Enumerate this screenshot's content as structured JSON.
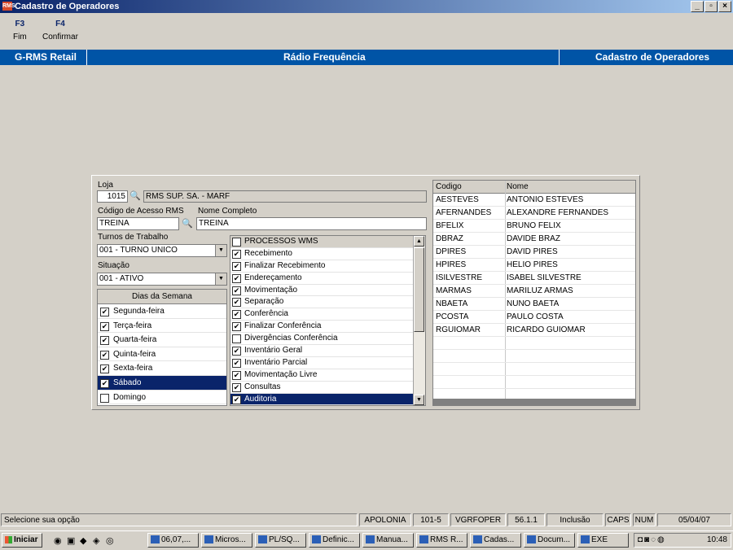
{
  "window": {
    "title": "Cadastro de Operadores",
    "app_icon": "RMS"
  },
  "fkeys": [
    {
      "key": "F3",
      "label": "Fim"
    },
    {
      "key": "F4",
      "label": "Confirmar"
    }
  ],
  "header": {
    "left": "G-RMS Retail",
    "center": "Rádio Frequência",
    "right": "Cadastro de Operadores"
  },
  "form": {
    "loja_label": "Loja",
    "loja_code": "1015",
    "loja_name": "RMS SUP. SA. - MARF",
    "codigo_label": "Código de Acesso RMS",
    "codigo_value": "TREINA",
    "nome_label": "Nome Completo",
    "nome_value": "TREINA",
    "turnos_label": "Turnos de Trabalho",
    "turnos_value": "001 - TURNO UNICO",
    "situacao_label": "Situação",
    "situacao_value": "001 - ATIVO"
  },
  "days": {
    "header": "Dias da Semana",
    "items": [
      {
        "label": "Segunda-feira",
        "checked": true
      },
      {
        "label": "Terça-feira",
        "checked": true
      },
      {
        "label": "Quarta-feira",
        "checked": true
      },
      {
        "label": "Quinta-feira",
        "checked": true
      },
      {
        "label": "Sexta-feira",
        "checked": true
      },
      {
        "label": "Sábado",
        "checked": true,
        "selected": true
      },
      {
        "label": "Domingo",
        "checked": false
      }
    ]
  },
  "processes": {
    "header": "PROCESSOS WMS",
    "items": [
      {
        "label": "Recebimento",
        "checked": true
      },
      {
        "label": "Finalizar Recebimento",
        "checked": true
      },
      {
        "label": "Endereçamento",
        "checked": true
      },
      {
        "label": "Movimentação",
        "checked": true
      },
      {
        "label": "Separação",
        "checked": true
      },
      {
        "label": "Conferência",
        "checked": true
      },
      {
        "label": "Finalizar Conferência",
        "checked": true
      },
      {
        "label": "Divergências Conferência",
        "checked": false
      },
      {
        "label": "Inventário Geral",
        "checked": true
      },
      {
        "label": "Inventário Parcial",
        "checked": true
      },
      {
        "label": "Movimentação Livre",
        "checked": true
      },
      {
        "label": "Consultas",
        "checked": true
      },
      {
        "label": "Auditoria",
        "checked": true,
        "selected": true
      }
    ]
  },
  "operators": {
    "columns": [
      "Codigo",
      "Nome"
    ],
    "rows": [
      [
        "AESTEVES",
        "ANTONIO ESTEVES"
      ],
      [
        "AFERNANDES",
        "ALEXANDRE FERNANDES"
      ],
      [
        "BFELIX",
        "BRUNO FELIX"
      ],
      [
        "DBRAZ",
        "DAVIDE BRAZ"
      ],
      [
        "DPIRES",
        "DAVID PIRES"
      ],
      [
        "HPIRES",
        "HELIO PIRES"
      ],
      [
        "ISILVESTRE",
        "ISABEL SILVESTRE"
      ],
      [
        "MARMAS",
        "MARILUZ ARMAS"
      ],
      [
        "NBAETA",
        "NUNO BAETA"
      ],
      [
        "PCOSTA",
        "PAULO COSTA"
      ],
      [
        "RGUIOMAR",
        "RICARDO GUIOMAR"
      ]
    ],
    "empty_rows": 6
  },
  "status": {
    "message": "Selecione sua opção",
    "server": "APOLONIA",
    "code": "101-5",
    "program": "VGRFOPER",
    "version": "56.1.1",
    "mode": "Inclusão",
    "caps": "CAPS",
    "num": "NUM",
    "date": "05/04/07"
  },
  "taskbar": {
    "start": "Iniciar",
    "tasks": [
      "06,07,...",
      "Micros...",
      "PL/SQ...",
      "Definic...",
      "Manua...",
      "RMS R...",
      "Cadas...",
      "Docum...",
      "EXE"
    ],
    "clock": "10:48"
  },
  "colors": {
    "accent": "#0054a6",
    "selection": "#0a246a",
    "face": "#d4d0c8"
  }
}
